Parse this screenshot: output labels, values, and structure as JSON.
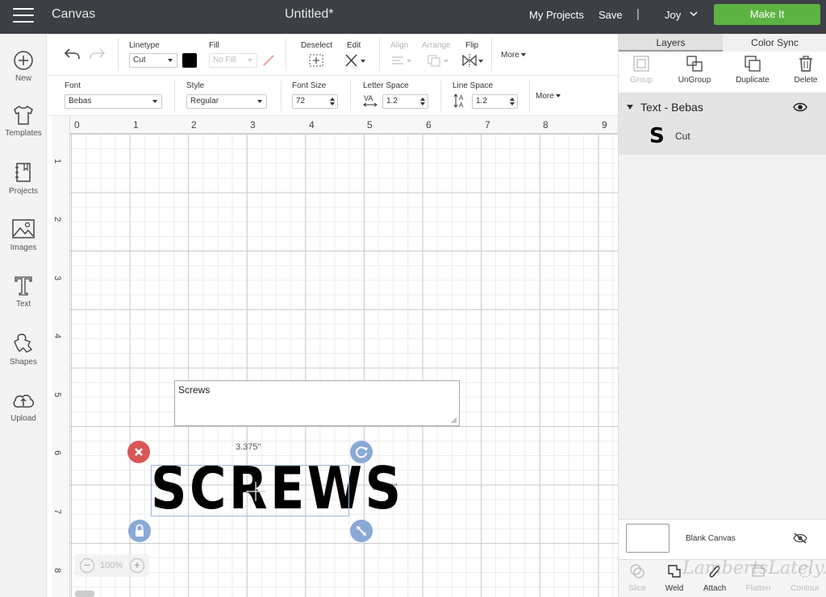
{
  "topbar": {
    "app_title": "Canvas",
    "doc_title": "Untitled*",
    "my_projects": "My Projects",
    "save": "Save",
    "separator": "|",
    "user": "Joy",
    "make_it": "Make It"
  },
  "sidebar": {
    "items": [
      {
        "label": "New",
        "icon": "plus-circle-icon"
      },
      {
        "label": "Templates",
        "icon": "shirt-icon"
      },
      {
        "label": "Projects",
        "icon": "notebook-icon"
      },
      {
        "label": "Images",
        "icon": "image-icon"
      },
      {
        "label": "Text",
        "icon": "text-t-icon"
      },
      {
        "label": "Shapes",
        "icon": "shapes-icon"
      },
      {
        "label": "Upload",
        "icon": "cloud-upload-icon"
      }
    ]
  },
  "toolbar1": {
    "linetype_label": "Linetype",
    "linetype_value": "Cut",
    "fill_label": "Fill",
    "fill_value": "No Fill",
    "deselect_label": "Deselect",
    "edit_label": "Edit",
    "align_label": "Align",
    "arrange_label": "Arrange",
    "flip_label": "Flip",
    "more_label": "More",
    "swatch_color": "#000000"
  },
  "toolbar2": {
    "font_label": "Font",
    "font_value": "Bebas",
    "style_label": "Style",
    "style_value": "Regular",
    "font_size_label": "Font Size",
    "font_size_value": "72",
    "letter_space_label": "Letter Space",
    "letter_space_value": "1.2",
    "line_space_label": "Line Space",
    "line_space_value": "1.2",
    "more_label": "More"
  },
  "canvas": {
    "ruler_top": [
      "0",
      "1",
      "2",
      "3",
      "4",
      "5",
      "6",
      "7",
      "8",
      "9"
    ],
    "ruler_left": [
      "1",
      "2",
      "3",
      "4",
      "5",
      "6",
      "7",
      "8"
    ],
    "text_edit_value": "Screws",
    "rendered_text": "SCREWS",
    "width_label": "3.375\"",
    "height_label": "0.913\"",
    "zoom": "100%"
  },
  "layers_panel": {
    "tabs": [
      "Layers",
      "Color Sync"
    ],
    "tools": [
      {
        "label": "Group",
        "enabled": false
      },
      {
        "label": "UnGroup",
        "enabled": true
      },
      {
        "label": "Duplicate",
        "enabled": true
      },
      {
        "label": "Delete",
        "enabled": true
      }
    ],
    "layer_name": "Text - Bebas",
    "layer_thumb": "S",
    "layer_sub": "Cut",
    "blank_canvas": "Blank Canvas",
    "bottom_tools": [
      {
        "label": "Slice",
        "enabled": false
      },
      {
        "label": "Weld",
        "enabled": true
      },
      {
        "label": "Attach",
        "enabled": true
      },
      {
        "label": "Flatten",
        "enabled": false
      },
      {
        "label": "Contour",
        "enabled": false
      }
    ]
  },
  "watermark": "LambertsLately.com",
  "colors": {
    "topbar": "#3c4046",
    "make_it": "#5db342",
    "delete_handle": "#d95757",
    "handle": "#8aa9d6"
  }
}
